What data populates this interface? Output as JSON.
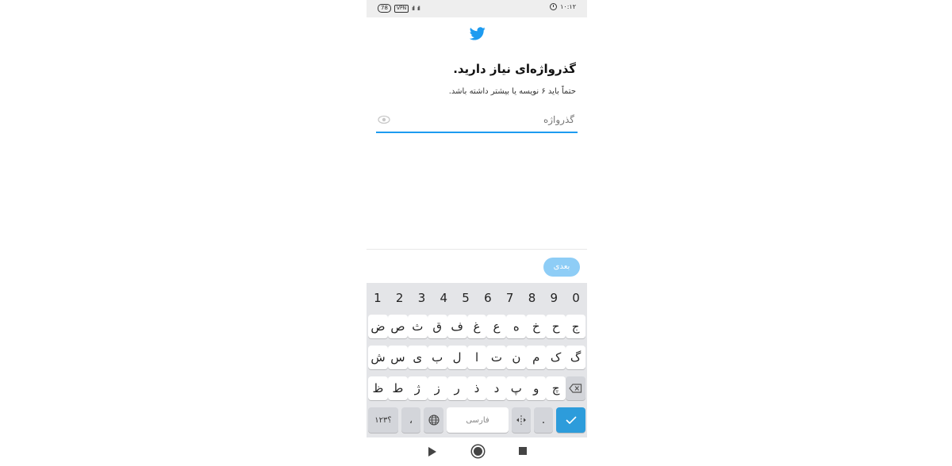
{
  "status_bar": {
    "battery": "78",
    "vpn": "VPN",
    "signal_1": "ıll",
    "signal_2": "ıll",
    "time": "۱۰:۱۲"
  },
  "header": {
    "logo_icon": "twitter-bird-icon",
    "brand_color": "#1d9bf0"
  },
  "main": {
    "title": "گذرواژه‌ای نیاز دارید.",
    "subtitle": "حتماً باید ۶ نویسه یا بیشتر داشته باشد.",
    "password_field": {
      "placeholder": "گذرواژه",
      "value": "",
      "toggle_icon": "eye-icon"
    }
  },
  "footer": {
    "next_label": "بعدی",
    "next_color": "#8ecdf6"
  },
  "keyboard": {
    "numbers": [
      "1",
      "2",
      "3",
      "4",
      "5",
      "6",
      "7",
      "8",
      "9",
      "0"
    ],
    "row1": [
      "ج",
      "ح",
      "خ",
      "ه",
      "ع",
      "غ",
      "ف",
      "ق",
      "ث",
      "ص",
      "ض"
    ],
    "row2": [
      "گ",
      "ک",
      "م",
      "ن",
      "ت",
      "ا",
      "ل",
      "ب",
      "ی",
      "س",
      "ش"
    ],
    "row3": [
      "چ",
      "و",
      "پ",
      "د",
      "ذ",
      "ر",
      "ز",
      "ژ",
      "ط",
      "ظ"
    ],
    "backspace_icon": "backspace-icon",
    "bottom": {
      "numeric_label": "؟۱۲۳",
      "comma_label": "،",
      "globe_icon": "globe-icon",
      "space_label": "فارسی",
      "cursor_icon": "cursor-move-icon",
      "period_label": ".",
      "enter_icon": "checkmark-icon",
      "enter_color": "#2d9cdb"
    }
  },
  "nav_bar": {
    "back_icon": "back-triangle-icon",
    "home_icon": "home-circle-icon",
    "recent_icon": "recent-square-icon"
  }
}
